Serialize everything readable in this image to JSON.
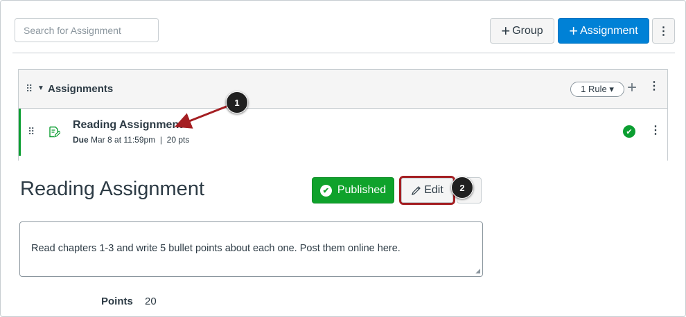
{
  "toolbar": {
    "search_placeholder": "Search for Assignment",
    "group_button": {
      "icon": "plus-icon",
      "label": "Group"
    },
    "assignment_button": {
      "icon": "plus-icon",
      "label": "Assignment"
    },
    "more_button": {
      "icon": "kebab-icon",
      "label": "⋮"
    }
  },
  "group": {
    "title": "Assignments",
    "rule_label": "1 Rule ▾",
    "add_icon": "plus-icon",
    "more_icon": "kebab-icon",
    "items": [
      {
        "title": "Reading Assignment",
        "due_label": "Due",
        "due_date": "Mar 8 at 11:59pm",
        "separator": "|",
        "points": "20 pts",
        "status": "published",
        "icon": "assignment-edit-icon"
      }
    ]
  },
  "detail": {
    "title": "Reading Assignment",
    "published_label": "Published",
    "edit_label": "Edit",
    "description": "Read chapters 1-3 and write 5 bullet points about each one. Post them online here.",
    "points_label": "Points",
    "points_value": "20"
  },
  "callouts": [
    "1",
    "2"
  ],
  "colors": {
    "primary": "#0081d6",
    "published": "#0fa22b",
    "callout_highlight": "#a41e22",
    "border": "#c7cdd1"
  }
}
